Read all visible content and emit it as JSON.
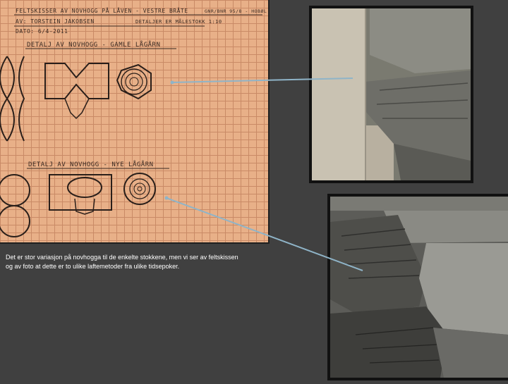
{
  "sketch": {
    "header_line1": "FELTSKISSER AV NOVHOGG PÅ LÅVEN - VESTRE BRÅTE",
    "header_right1": "GNR/BNR 95/8 - HOBØL",
    "header_line2": "AV: TORSTEIN JAKOBSEN",
    "header_right2": "DETALJER ER MÅLESTOKK 1:10",
    "header_line3": "DATO: 6/4-2011",
    "detail1_title": "DETALJ AV NOVHOGG - GAMLE LÅGÅRN",
    "detail2_title": "DETALJ AV NOVHOGG - NYE LÅGÅRN"
  },
  "caption": {
    "line1": "Det er stor variasjon på novhogga til de enkelte stokkene, men vi ser av feltskissen",
    "line2": "og av foto at dette er to ulike laftemetoder fra ulike tidsepoker."
  },
  "colors": {
    "background": "#404040",
    "grid_paper": "#e8b088",
    "arrow": "#8fb4c8"
  },
  "icons": {
    "photo_old": "old-timber-notch-photo",
    "photo_new": "new-timber-notch-photo"
  }
}
